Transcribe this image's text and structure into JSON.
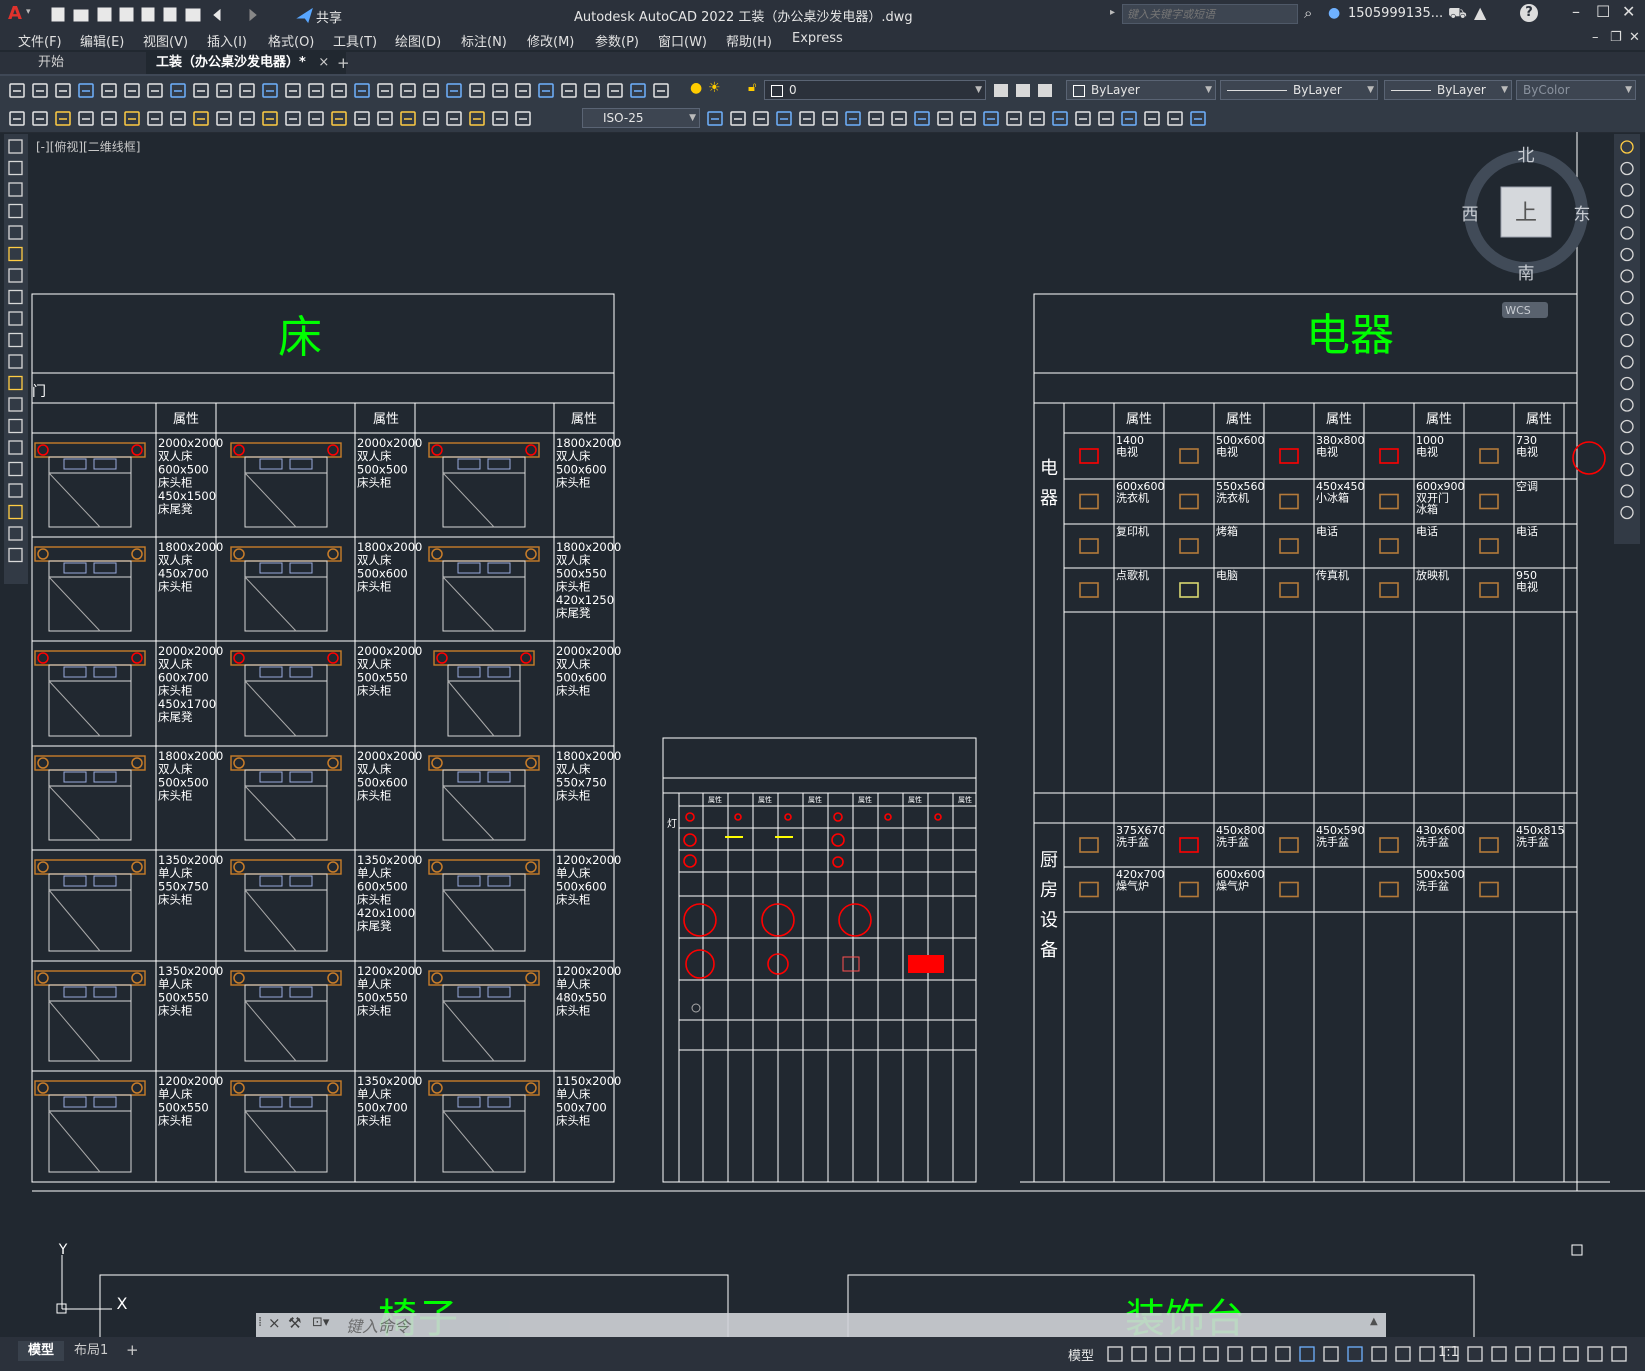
{
  "app": {
    "title": "Autodesk AutoCAD 2022    工装（办公桌沙发电器）.dwg",
    "logo": "A",
    "share_label": "共享",
    "search_placeholder": "键入关键字或短语",
    "user": "1505999135...",
    "help": "?"
  },
  "menu": [
    "文件(F)",
    "编辑(E)",
    "视图(V)",
    "插入(I)",
    "格式(O)",
    "工具(T)",
    "绘图(D)",
    "标注(N)",
    "修改(M)",
    "参数(P)",
    "窗口(W)",
    "帮助(H)",
    "Express"
  ],
  "tabs": {
    "start": "开始",
    "active": "工装（办公桌沙发电器）*",
    "close": "×",
    "add": "+"
  },
  "toolbar": {
    "layer": "0",
    "color": "ByLayer",
    "linetype": "ByLayer",
    "lineweight": "ByLayer",
    "plotstyle": "ByColor",
    "dimstyle": "ISO-25"
  },
  "viewport": {
    "label": "[-][俯视][二维线框]"
  },
  "viewcube": {
    "north": "北",
    "south": "南",
    "east": "东",
    "west": "西",
    "top": "上",
    "wcs": "WCS"
  },
  "drawing": {
    "bed_title": "床",
    "elec_title": "电器",
    "chair_title": "椅子",
    "deco_title": "装饰台",
    "bed_sub": "门",
    "lamp_label": "灯",
    "attr_header": "属性",
    "bed_attrs": [
      [
        "2000x2000\n双人床\n600x500\n床头柜\n450x1500\n床尾凳",
        "2000x2000\n双人床\n500x500\n床头柜",
        "1800x2000\n双人床\n500x600\n床头柜"
      ],
      [
        "1800x2000\n双人床\n450x700\n床头柜",
        "1800x2000\n双人床\n500x600\n床头柜",
        "1800x2000\n双人床\n500x550\n床头柜\n420x1250\n床尾凳"
      ],
      [
        "2000x2000\n双人床\n600x700\n床头柜\n450x1700\n床尾凳",
        "2000x2000\n双人床\n500x550\n床头柜",
        "2000x2000\n双人床\n500x600\n床头柜"
      ],
      [
        "1800x2000\n双人床\n500x500\n床头柜",
        "2000x2000\n双人床\n500x600\n床头柜",
        "1800x2000\n双人床\n550x750\n床头柜"
      ],
      [
        "1350x2000\n单人床\n550x750\n床头柜",
        "1350x2000\n单人床\n600x500\n床头柜\n420x1000\n床尾凳",
        "1200x2000\n单人床\n500x600\n床头柜"
      ],
      [
        "1350x2000\n单人床\n500x550\n床头柜",
        "1200x2000\n单人床\n500x550\n床头柜",
        "1200x2000\n单人床\n480x550\n床头柜"
      ],
      [
        "1200x2000\n单人床\n500x550\n床头柜",
        "1350x2000\n单人床\n500x700\n床头柜",
        "1150x2000\n单人床\n500x700\n床头柜"
      ]
    ],
    "elec_side": "电\n器",
    "elec_rows": [
      [
        "1400\n电视",
        "500x600\n电视",
        "380x800\n电视",
        "1000\n电视",
        "730\n电视"
      ],
      [
        "600x600\n洗衣机",
        "550x560\n洗衣机",
        "450x450\n小冰箱",
        "600x900\n双开门\n冰箱",
        "空调"
      ],
      [
        "复印机",
        "烤箱",
        "电话",
        "电话",
        "电话"
      ],
      [
        "点歌机",
        "电脑",
        "传真机",
        "放映机",
        "950\n电视"
      ]
    ],
    "kitchen_side": "厨\n房\n设\n备",
    "kitchen_rows": [
      [
        "375X670\n洗手盆",
        "450x800\n洗手盆",
        "450x590\n洗手盆",
        "430x600\n洗手盆",
        "450x815\n洗手盆"
      ],
      [
        "420x700\n燥气炉",
        "600x600\n燥气炉",
        "",
        "500x500\n洗手盆",
        ""
      ]
    ]
  },
  "ucs": {
    "x": "X",
    "y": "Y"
  },
  "command": {
    "placeholder": "键入命令",
    "close": "×"
  },
  "layout_tabs": [
    "模型",
    "布局1",
    "+"
  ],
  "status": {
    "model": "模型",
    "scale": "1:1"
  },
  "colors": {
    "bg": "#212830",
    "green": "#00ff00",
    "yellow": "#ffff00",
    "red": "#ff0000",
    "orange": "#c87d2a",
    "white": "#ffffff"
  }
}
